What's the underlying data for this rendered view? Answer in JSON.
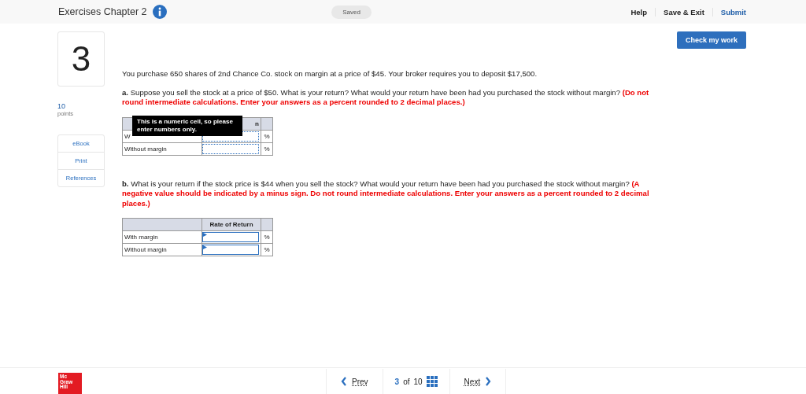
{
  "header": {
    "title": "Exercises Chapter 2",
    "status": "Saved",
    "links": [
      {
        "label": "Help",
        "kind": "plain"
      },
      {
        "label": "Save & Exit",
        "kind": "plain"
      },
      {
        "label": "Submit",
        "kind": "primary"
      }
    ]
  },
  "check_button": "Check my work",
  "question": {
    "number": "3",
    "points": "10",
    "points_label": "points",
    "tools": [
      "eBook",
      "Print",
      "References"
    ]
  },
  "intro": "You purchase 650 shares of 2nd Chance Co. stock on margin at a price of $45. Your broker requires you to deposit $17,500.",
  "parts": [
    {
      "text": "**a.** Suppose you sell the stock at a price of $50. What is your return? What would your return have been had you purchased the stock without margin?",
      "instruction": "(Do not round intermediate calculations. Enter your answers as a percent rounded to 2 decimal places.)",
      "kind": "dotted",
      "header": "n",
      "rows": [
        {
          "label": "W",
          "unit": "%"
        },
        {
          "label": "Without margin",
          "unit": "%"
        }
      ],
      "tooltip": "This is a numeric cell, so please enter numbers only."
    },
    {
      "text": "**b.** What is your return if the stock price is $44 when you sell the stock? What would your return have been had you purchased the stock without margin?",
      "instruction": "(A negative value should be indicated by a minus sign. Do not round intermediate calculations. Enter your answers as a percent rounded to 2 decimal places.)",
      "kind": "solid",
      "header": "Rate of Return",
      "rows": [
        {
          "label": "With margin",
          "unit": "%"
        },
        {
          "label": "Without margin",
          "unit": "%"
        }
      ]
    }
  ],
  "footer": {
    "logo": [
      "Mc",
      "Graw",
      "Hill"
    ],
    "prev": "Prev",
    "current": "3",
    "of": "of",
    "total": "10",
    "next": "Next"
  }
}
